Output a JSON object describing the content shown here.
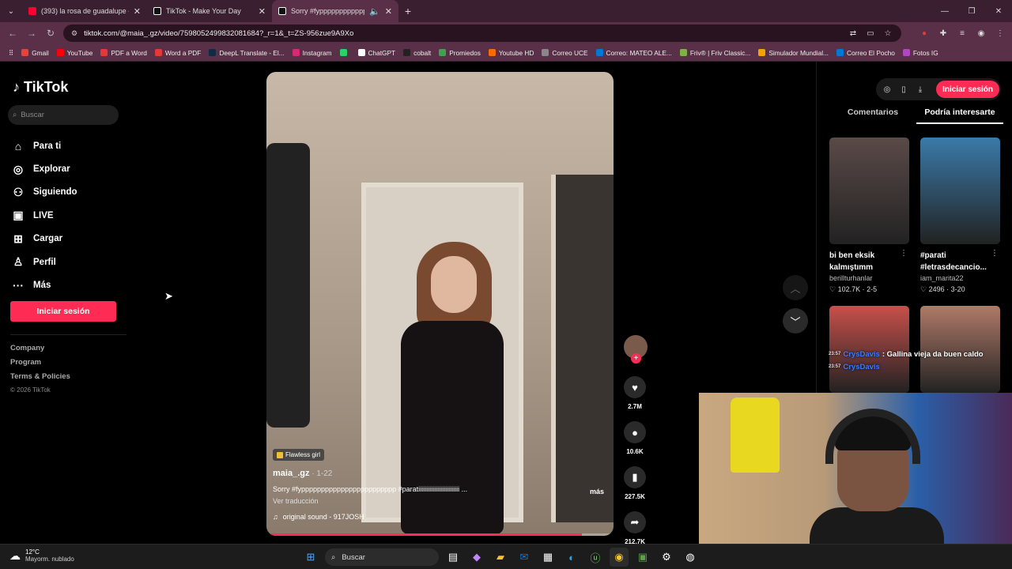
{
  "browser": {
    "tabs": [
      {
        "title": "(393) la rosa de guadalupe - Yo",
        "color": "#ff0033"
      },
      {
        "title": "TikTok - Make Your Day",
        "color": "#ffffff"
      },
      {
        "title": "Sorry #fypppppppppppppp",
        "color": "#ffffff"
      }
    ],
    "url": "tiktok.com/@maia_.gz/video/7598052499832081684?_r=1&_t=ZS-956zue9A9Xo",
    "bookmarks": [
      {
        "label": "Gmail",
        "color": "#ea4335"
      },
      {
        "label": "YouTube",
        "color": "#ff0000"
      },
      {
        "label": "PDF a Word",
        "color": "#e53935"
      },
      {
        "label": "Word a PDF",
        "color": "#e53935"
      },
      {
        "label": "DeepL Translate - El...",
        "color": "#0f2b46"
      },
      {
        "label": "Instagram",
        "color": "#d62976"
      },
      {
        "label": "",
        "color": "#25d366"
      },
      {
        "label": "ChatGPT",
        "color": "#ffffff"
      },
      {
        "label": "cobalt",
        "color": "#222222"
      },
      {
        "label": "Promiedos",
        "color": "#3fa34d"
      },
      {
        "label": "Youtube HD",
        "color": "#ff6a00"
      },
      {
        "label": "Correo UCE",
        "color": "#888888"
      },
      {
        "label": "Correo: MATEO ALE...",
        "color": "#0078d4"
      },
      {
        "label": "Friv® | Friv Classic...",
        "color": "#7cb342"
      },
      {
        "label": "Simulador Mundial...",
        "color": "#f4a300"
      },
      {
        "label": "Correo El Pocho",
        "color": "#0078d4"
      },
      {
        "label": "Fotos IG",
        "color": "#b146c2"
      }
    ]
  },
  "sidebar": {
    "logo": "TikTok",
    "search_placeholder": "Buscar",
    "items": [
      {
        "label": "Para ti",
        "icon": "home-icon",
        "glyph": "⌂"
      },
      {
        "label": "Explorar",
        "icon": "compass-icon",
        "glyph": "◎"
      },
      {
        "label": "Siguiendo",
        "icon": "following-icon",
        "glyph": "⚇"
      },
      {
        "label": "LIVE",
        "icon": "live-icon",
        "glyph": "▣"
      },
      {
        "label": "Cargar",
        "icon": "upload-icon",
        "glyph": "⊞"
      },
      {
        "label": "Perfil",
        "icon": "profile-icon",
        "glyph": "♙"
      },
      {
        "label": "Más",
        "icon": "more-icon",
        "glyph": "···"
      }
    ],
    "login_label": "Iniciar sesión",
    "footer": [
      "Company",
      "Program",
      "Terms & Policies"
    ],
    "copyright": "© 2026 TikTok"
  },
  "video": {
    "tag": "Flawless girl",
    "author": "maia_.gz",
    "date": " · 1-22",
    "caption": "Sorry #fypppppppppppppppppppppppp #paratiiiiiiiiiiiiiiiiiiiiiiiiii ...",
    "more_label": "más",
    "translate_label": "Ver traducción",
    "sound": "original sound - 917JOSH",
    "progress": 0.91
  },
  "actions": {
    "likes": "2.7M",
    "comments": "10.6K",
    "saves": "227.5K",
    "shares": "212.7K"
  },
  "right_panel": {
    "login_label": "Iniciar sesión",
    "tabs": [
      "Comentarios",
      "Podría interesarte"
    ],
    "cards": [
      {
        "title": "bi ben eksik kalmıştımm",
        "author": "berillturhanlar",
        "stats": "♡ 102.7K · 2-5",
        "color": "#5a4a48"
      },
      {
        "title": "#parati #letrasdecancio...",
        "author": "iam_marita22",
        "stats": "♡ 2496 · 3-20",
        "color": "#3a7aa8"
      },
      {
        "title": "",
        "author": "",
        "stats": "",
        "color": "#c8504a"
      },
      {
        "title": "",
        "author": "",
        "stats": "",
        "color": "#b07a68"
      }
    ]
  },
  "chat": [
    {
      "time": "23:57",
      "name": "CrysDavis",
      "msg": ": Gallina vieja da buen caldo"
    },
    {
      "time": "23:57",
      "name": "CrysDavis",
      "msg": ""
    }
  ],
  "taskbar": {
    "temp": "12°C",
    "weather": "Mayorm. nublado",
    "search": "Buscar"
  }
}
